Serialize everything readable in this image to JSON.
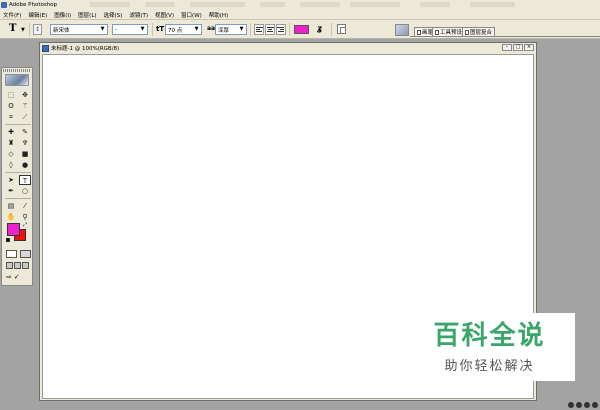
{
  "titlebar": {
    "title": "Adobe Photoshop"
  },
  "menubar": {
    "items": [
      "文件(F)",
      "编辑(E)",
      "图像(I)",
      "图层(L)",
      "选择(S)",
      "滤镜(T)",
      "视图(V)",
      "窗口(W)",
      "帮助(H)"
    ]
  },
  "options": {
    "tool_glyph": "T",
    "font_family": "新宋体",
    "font_style": "-",
    "font_size": "70 点",
    "antialias": "浑厚",
    "aa_label": "aa",
    "text_color": "#ee22cc",
    "icons": {
      "tool": "text-tool-icon",
      "orientation": "text-orientation-icon",
      "size": "font-size-icon",
      "align_left": "align-left-icon",
      "align_center": "align-center-icon",
      "align_right": "align-right-icon",
      "warp": "warp-text-icon",
      "palettes": "toggle-palettes-icon"
    }
  },
  "palette_well": {
    "tabs": [
      "画笔",
      "工具预设",
      "图层复合"
    ]
  },
  "toolbox": {
    "foreground_color": "#ee22cc",
    "background_color": "#ee1111"
  },
  "document": {
    "title": "未标题-1 @ 100%(RGB/8)"
  },
  "watermark": {
    "title": "百科全说",
    "subtitle": "助你轻松解决"
  }
}
